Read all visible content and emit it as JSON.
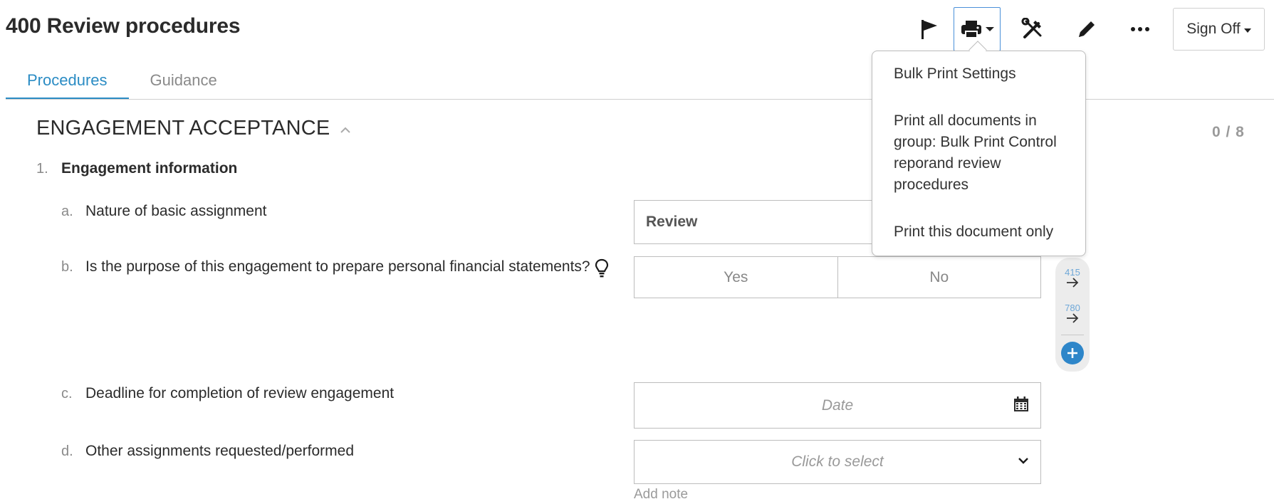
{
  "header": {
    "title": "400 Review procedures",
    "toolbar": {
      "flag_icon": "flag-icon",
      "print_icon": "printer-icon",
      "tools_icon": "tools-icon",
      "edit_icon": "pencil-icon",
      "more_icon": "more-horizontal-icon",
      "sign_off_label": "Sign Off"
    }
  },
  "tabs": [
    {
      "label": "Procedures",
      "active": true
    },
    {
      "label": "Guidance",
      "active": false
    }
  ],
  "section": {
    "title": "ENGAGEMENT ACCEPTANCE",
    "count": "0 / 8"
  },
  "questions": {
    "group_number": "1.",
    "group_label": "Engagement information",
    "a": {
      "letter": "a.",
      "text": "Nature of basic assignment",
      "value": "Review"
    },
    "b": {
      "letter": "b.",
      "text": "Is the purpose of this engagement to prepare personal financial statements?",
      "yes_label": "Yes",
      "no_label": "No"
    },
    "c": {
      "letter": "c.",
      "text": "Deadline for completion of review engagement",
      "placeholder": "Date"
    },
    "d": {
      "letter": "d.",
      "text": "Other assignments requested/performed",
      "placeholder": "Click to select"
    }
  },
  "add_note": "Add note",
  "side_rail": {
    "links": [
      {
        "number": "415"
      },
      {
        "number": "780"
      }
    ]
  },
  "print_menu": {
    "items": [
      "Bulk Print Settings",
      "Print all documents in group: Bulk Print Control reporand review procedures",
      "Print this document only"
    ]
  },
  "colors": {
    "accent": "#2b8cc4",
    "rail_link": "#6fa8d8",
    "add_button": "#2e86c9"
  }
}
